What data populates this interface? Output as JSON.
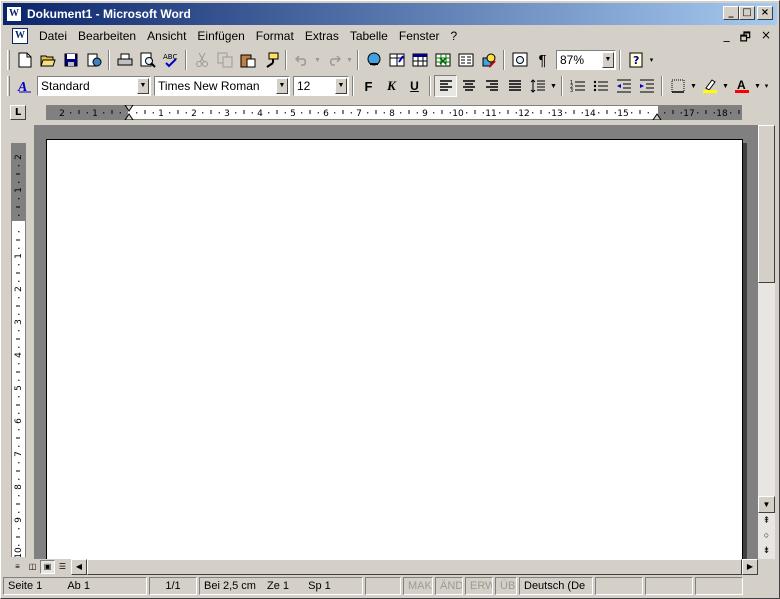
{
  "window": {
    "title": "Dokument1 - Microsoft Word",
    "icon_letter": "W",
    "controls": {
      "minimize": "_",
      "maximize": "□",
      "close": "×"
    }
  },
  "menubar": {
    "items": [
      {
        "label": "Datei"
      },
      {
        "label": "Bearbeiten"
      },
      {
        "label": "Ansicht"
      },
      {
        "label": "Einfügen"
      },
      {
        "label": "Format"
      },
      {
        "label": "Extras"
      },
      {
        "label": "Tabelle"
      },
      {
        "label": "Fenster"
      },
      {
        "label": "?"
      }
    ],
    "doc_controls": {
      "minimize": "_",
      "restore": "🗗",
      "close": "×"
    }
  },
  "standard_toolbar": {
    "zoom": "87%"
  },
  "format_toolbar": {
    "style": "Standard",
    "font": "Times New Roman",
    "size": "12",
    "bold_label": "F",
    "italic_label": "K",
    "underline_label": "U",
    "highlight_color": "#ffff00",
    "font_color": "#ff0000"
  },
  "ruler": {
    "corner_label": "L",
    "h_numbers": [
      "2",
      "1",
      "",
      "1",
      "2",
      "3",
      "4",
      "5",
      "6",
      "7",
      "8",
      "9",
      "10",
      "11",
      "12",
      "13",
      "14",
      "15",
      "",
      "17",
      "18"
    ],
    "v_numbers": [
      "2",
      "1",
      "",
      "1",
      "2",
      "3",
      "4",
      "5",
      "6",
      "7",
      "8",
      "9",
      "10"
    ]
  },
  "statusbar": {
    "page": "Seite  1",
    "section": "Ab  1",
    "pages": "1/1",
    "position": "Bei  2,5 cm",
    "line": "Ze  1",
    "column": "Sp  1",
    "rec": "MAK",
    "trk": "ÄND",
    "ext": "ERW",
    "ovr": "ÜB",
    "language": "Deutsch (De"
  }
}
